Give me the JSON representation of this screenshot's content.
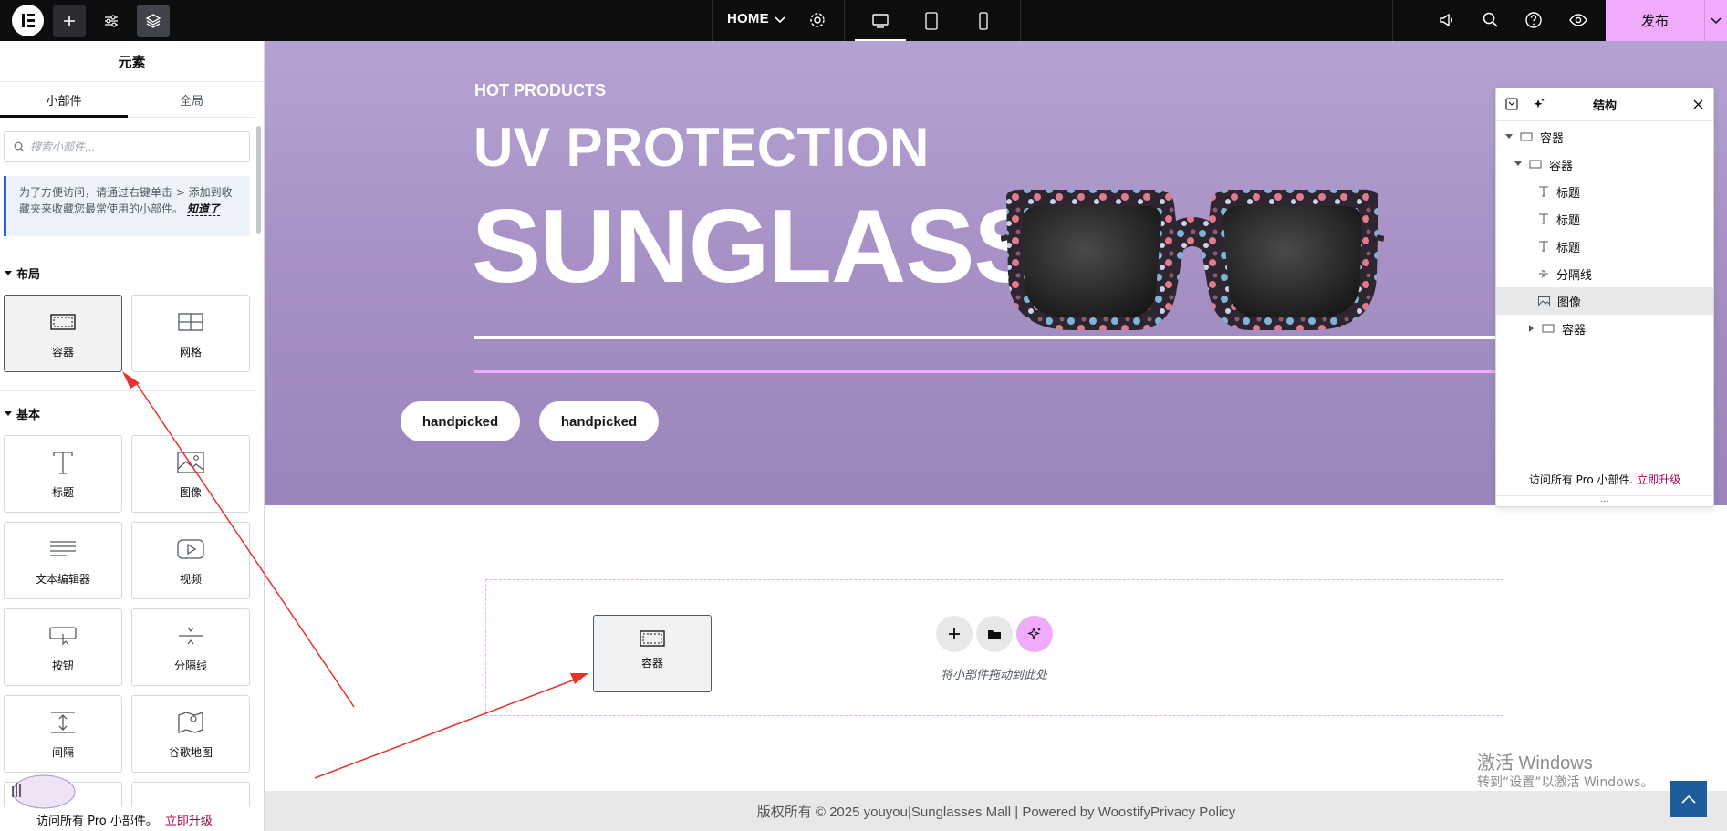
{
  "topbar": {
    "page_name": "HOME",
    "publish_label": "发布"
  },
  "panel": {
    "title": "元素",
    "tabs": [
      "小部件",
      "全局"
    ],
    "search_placeholder": "搜索小部件...",
    "notice": {
      "text": "为了方便访问，请通过右键单击 > 添加到收藏夹来收藏您最常使用的小部件。",
      "link": "知道了"
    },
    "sections": {
      "layout": "布局",
      "basic": "基本"
    },
    "layout_widgets": [
      {
        "label": "容器",
        "icon": "container-icon"
      },
      {
        "label": "网格",
        "icon": "grid-icon"
      }
    ],
    "basic_widgets": [
      {
        "label": "标题",
        "icon": "heading-icon"
      },
      {
        "label": "图像",
        "icon": "image-icon"
      },
      {
        "label": "文本编辑器",
        "icon": "text-editor-icon"
      },
      {
        "label": "视频",
        "icon": "video-icon"
      },
      {
        "label": "按钮",
        "icon": "button-icon"
      },
      {
        "label": "分隔线",
        "icon": "divider-icon"
      },
      {
        "label": "间隔",
        "icon": "spacer-icon"
      },
      {
        "label": "谷歌地图",
        "icon": "map-icon"
      }
    ],
    "footer": {
      "text": "访问所有 Pro 小部件。",
      "link": "立即升级"
    }
  },
  "hero": {
    "eyebrow": "HOT PRODUCTS",
    "headline": "UV PROTECTION",
    "big_word": "SUNGLASS",
    "buttons": [
      "handpicked",
      "handpicked"
    ]
  },
  "drop_zone": {
    "hint": "将小部件拖动到此处",
    "ghost_label": "容器"
  },
  "site_footer": {
    "text": "版权所有 © 2025 youyou|Sunglasses Mall | Powered by WoostifyPrivacy Policy"
  },
  "watermark": {
    "line1": "激活 Windows",
    "line2": "转到“设置”以激活 Windows。"
  },
  "navigator": {
    "title": "结构",
    "items": [
      {
        "label": "容器",
        "type": "container"
      },
      {
        "label": "容器",
        "type": "container"
      },
      {
        "label": "标题",
        "type": "heading"
      },
      {
        "label": "标题",
        "type": "heading"
      },
      {
        "label": "标题",
        "type": "heading"
      },
      {
        "label": "分隔线",
        "type": "divider"
      },
      {
        "label": "图像",
        "type": "image",
        "selected": true
      },
      {
        "label": "容器",
        "type": "container"
      }
    ],
    "footer": {
      "text": "访问所有 Pro 小部件.",
      "link": "立即升级"
    }
  },
  "colors": {
    "accent": "#f0abfc",
    "topbar": "#0c0d0e",
    "hero": "#a891c6",
    "upgrade_link": "#a4004f",
    "arrow": "#e8322b"
  }
}
